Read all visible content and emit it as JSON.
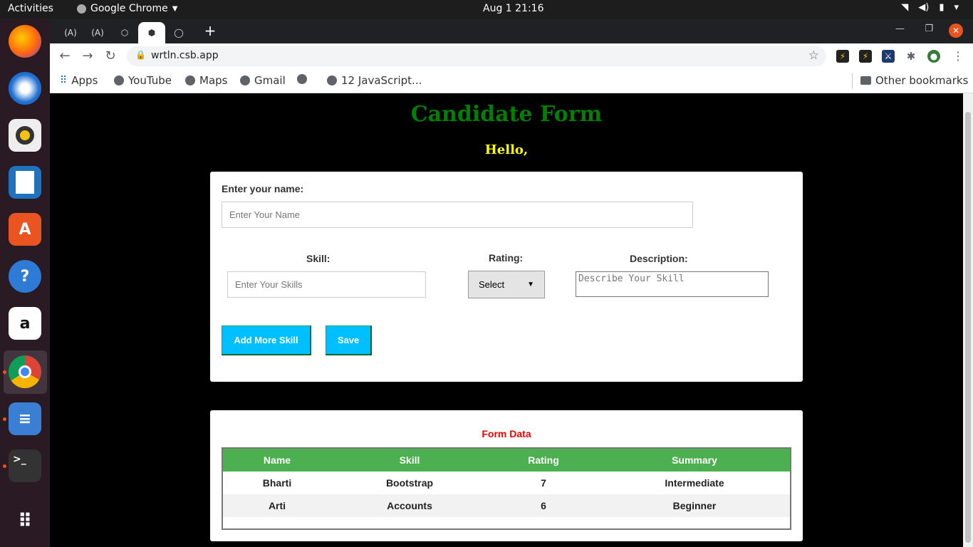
{
  "topbar": {
    "activities": "Activities",
    "app_name": "Google Chrome",
    "clock": "Aug 1  21:16"
  },
  "browser": {
    "url": "wrtln.csb.app",
    "bookmarks": [
      "Apps",
      "YouTube",
      "Maps",
      "Gmail",
      "",
      "12 JavaScript...",
      "Other bookmarks"
    ]
  },
  "page": {
    "title": "Candidate Form",
    "greeting": "Hello,",
    "form": {
      "name_label": "Enter your name:",
      "name_placeholder": "Enter Your Name",
      "skill_label": "Skill:",
      "skill_placeholder": "Enter Your Skills",
      "rating_label": "Rating:",
      "rating_value": "Select",
      "description_label": "Description:",
      "description_placeholder": "Describe Your Skill",
      "add_button": "Add More Skill",
      "save_button": "Save"
    },
    "form_data": {
      "title": "Form Data",
      "headers": [
        "Name",
        "Skill",
        "Rating",
        "Summary"
      ],
      "rows": [
        [
          "Bharti",
          "Bootstrap",
          "7",
          "Intermediate"
        ],
        [
          "Arti",
          "Accounts",
          "6",
          "Beginner"
        ]
      ]
    }
  },
  "colors": {
    "title": "#008000",
    "greeting": "#ffff00",
    "button": "#00bfff",
    "table_header": "#4caf50",
    "form_data_title": "#ee0000"
  }
}
